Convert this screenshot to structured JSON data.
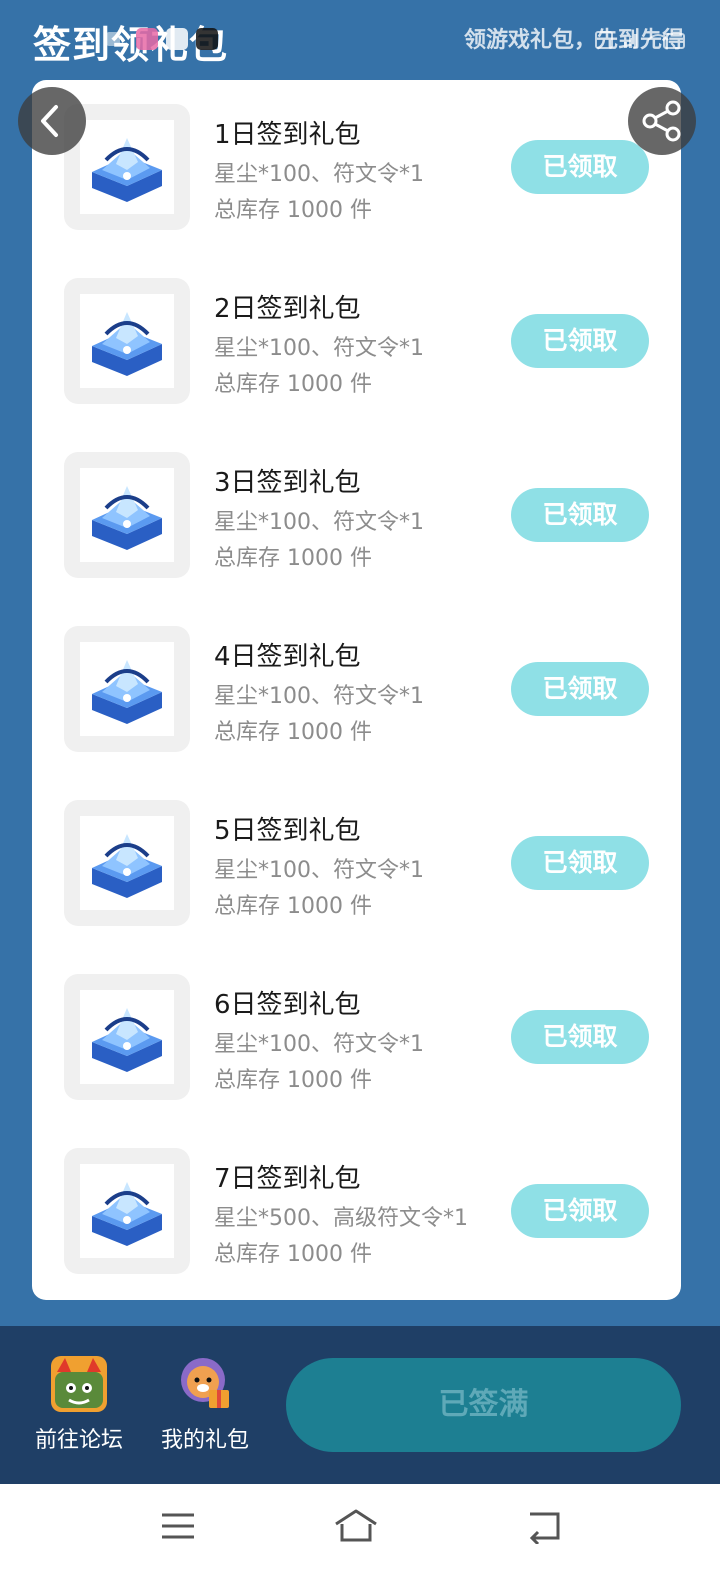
{
  "header": {
    "title": "签到领礼包",
    "subtitle": "领游戏礼包，先到先得"
  },
  "gifts": [
    {
      "title": "1日签到礼包",
      "desc": "星尘*100、符文令*1",
      "stock": "总库存 1000 件",
      "button": "已领取"
    },
    {
      "title": "2日签到礼包",
      "desc": "星尘*100、符文令*1",
      "stock": "总库存 1000 件",
      "button": "已领取"
    },
    {
      "title": "3日签到礼包",
      "desc": "星尘*100、符文令*1",
      "stock": "总库存 1000 件",
      "button": "已领取"
    },
    {
      "title": "4日签到礼包",
      "desc": "星尘*100、符文令*1",
      "stock": "总库存 1000 件",
      "button": "已领取"
    },
    {
      "title": "5日签到礼包",
      "desc": "星尘*100、符文令*1",
      "stock": "总库存 1000 件",
      "button": "已领取"
    },
    {
      "title": "6日签到礼包",
      "desc": "星尘*100、符文令*1",
      "stock": "总库存 1000 件",
      "button": "已领取"
    },
    {
      "title": "7日签到礼包",
      "desc": "星尘*500、高级符文令*1",
      "stock": "总库存 1000 件",
      "button": "已领取"
    }
  ],
  "bottom_bar": {
    "forum_label": "前往论坛",
    "my_gifts_label": "我的礼包",
    "signed_button": "已签满"
  },
  "icons": {
    "back": "chevron-left-icon",
    "share": "share-icon",
    "gift": "treasure-chest-icon",
    "nav_menu": "menu-icon",
    "nav_home": "home-icon",
    "nav_back": "back-icon"
  },
  "colors": {
    "background": "#3672a8",
    "claimed_button": "#8fe0e6",
    "bottom_bar": "#1f3f66",
    "signed_button": "#1d7f92"
  }
}
